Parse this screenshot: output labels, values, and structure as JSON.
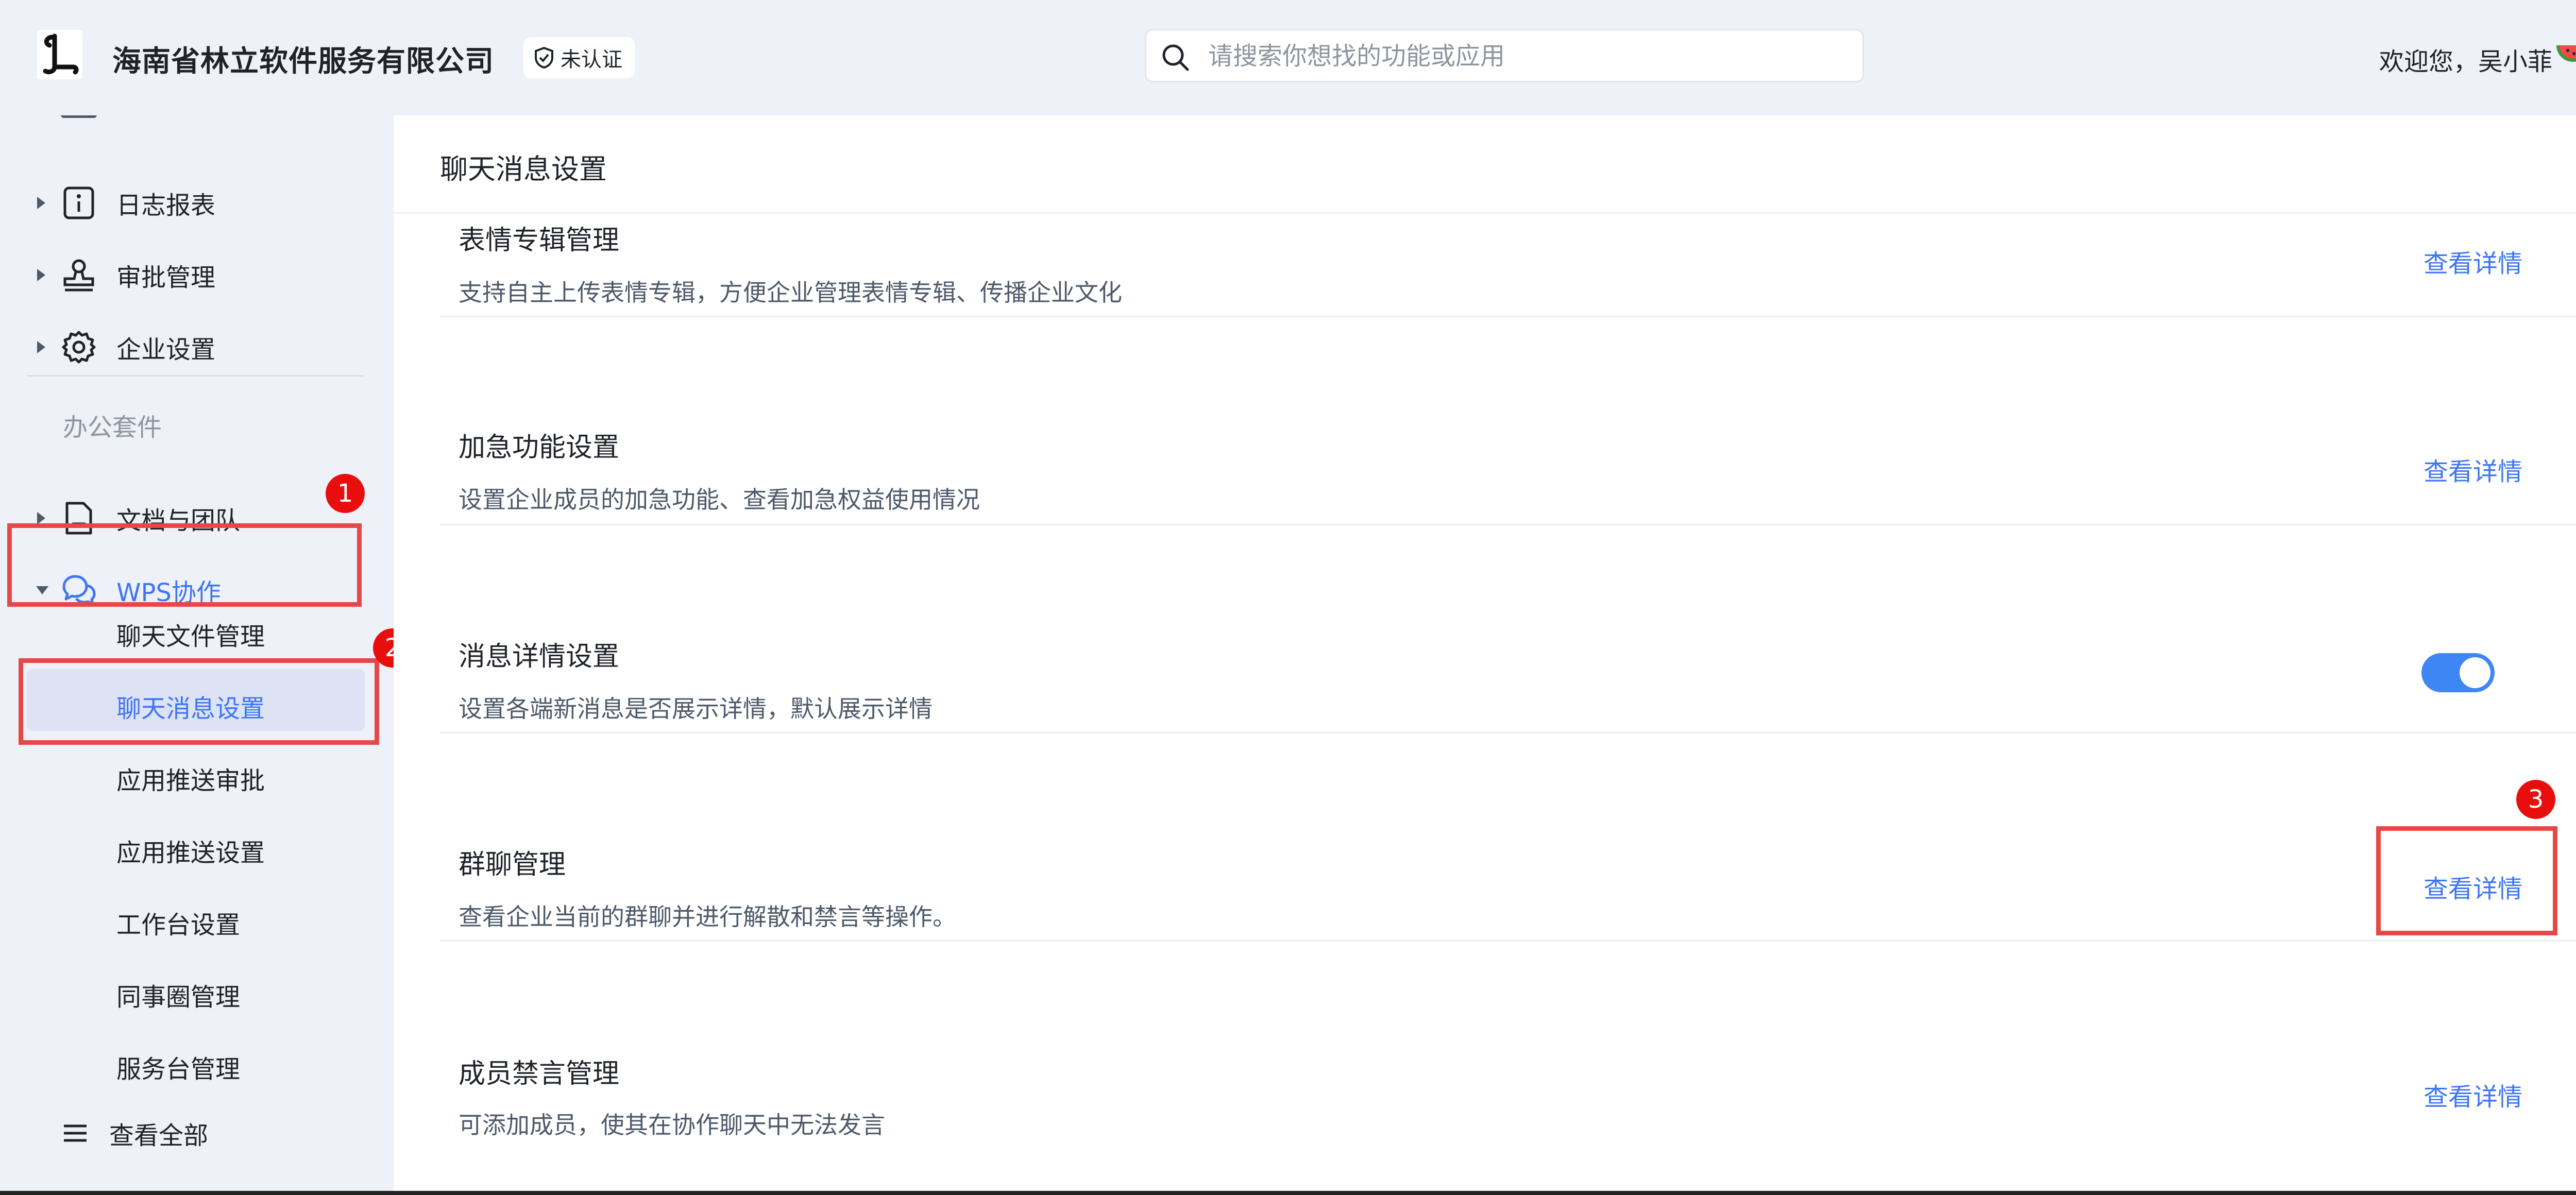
{
  "header": {
    "company_name": "海南省林立软件服务有限公司",
    "auth_badge": "未认证",
    "search_placeholder": "请搜索你想找的功能或应用",
    "welcome": "欢迎您，吴小菲"
  },
  "sidebar": {
    "items": [
      {
        "label": "日志报表"
      },
      {
        "label": "审批管理"
      },
      {
        "label": "企业设置"
      }
    ],
    "section_title": "办公套件",
    "office_items": [
      {
        "label": "文档与团队"
      },
      {
        "label": "WPS协作"
      }
    ],
    "sub_items": [
      {
        "label": "聊天文件管理"
      },
      {
        "label": "聊天消息设置"
      },
      {
        "label": "应用推送审批"
      },
      {
        "label": "应用推送设置"
      },
      {
        "label": "工作台设置"
      },
      {
        "label": "同事圈管理"
      },
      {
        "label": "服务台管理"
      }
    ],
    "view_all": "查看全部"
  },
  "main": {
    "title": "聊天消息设置",
    "settings": [
      {
        "title": "表情专辑管理",
        "desc": "支持自主上传表情专辑，方便企业管理表情专辑、传播企业文化",
        "action": "查看详情"
      },
      {
        "title": "加急功能设置",
        "desc": "设置企业成员的加急功能、查看加急权益使用情况",
        "action": "查看详情"
      },
      {
        "title": "消息详情设置",
        "desc": "设置各端新消息是否展示详情，默认展示详情",
        "toggle_on": true
      },
      {
        "title": "群聊管理",
        "desc": "查看企业当前的群聊并进行解散和禁言等操作。",
        "action": "查看详情"
      },
      {
        "title": "成员禁言管理",
        "desc": "可添加成员，使其在协作聊天中无法发言",
        "action": "查看详情"
      }
    ]
  },
  "annotations": {
    "step1": "1",
    "step2": "2",
    "step3": "3",
    "color": "#e64848"
  }
}
